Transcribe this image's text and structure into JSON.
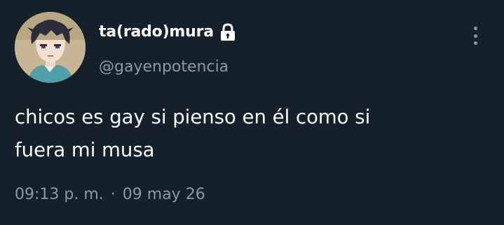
{
  "user": {
    "display_name": "ta(rado)mura",
    "handle": "@gayenpotencia",
    "protected_icon": "lock-icon",
    "avatar_icon": "anime-character-avatar"
  },
  "tweet": {
    "text_line_1": "chicos es gay si pienso en él como si",
    "text_line_2": "fuera mi musa",
    "time": "09:13 p. m.",
    "separator": "·",
    "date": "09 may 26"
  },
  "actions": {
    "more_icon": "more-vertical-icon"
  },
  "colors": {
    "background": "#15202b",
    "primary_text": "#ffffff",
    "secondary_text": "#8b98a5"
  }
}
